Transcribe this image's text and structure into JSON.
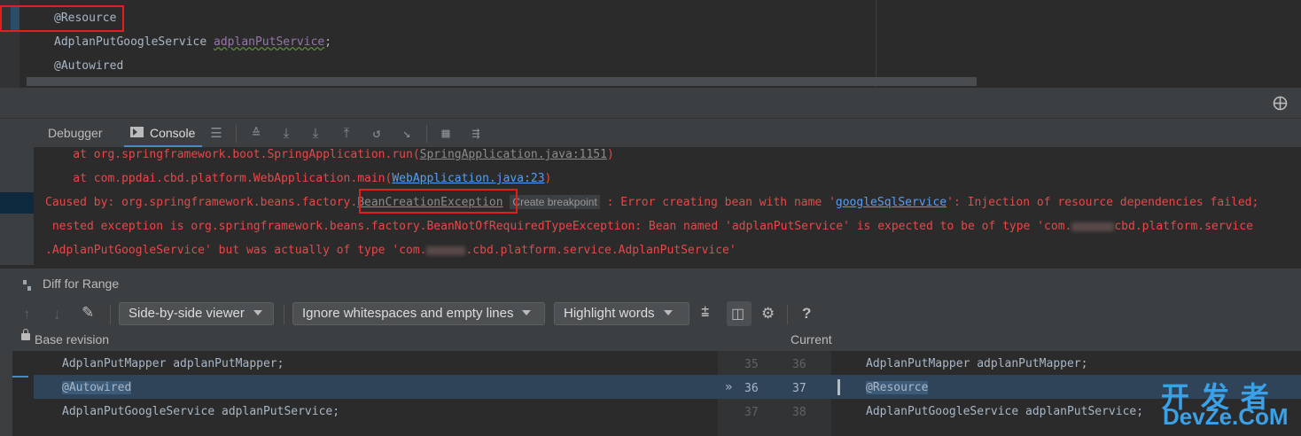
{
  "editor": {
    "lines": [
      {
        "kind": "annotation",
        "text": "@Resource"
      },
      {
        "type": "AdplanPutGoogleService",
        "field": "adplanPutService",
        "tail": ";"
      },
      {
        "kind": "annotation",
        "text": "@Autowired"
      }
    ]
  },
  "toolwindow": {
    "tabs": [
      {
        "label": "Debugger"
      },
      {
        "label": "Console"
      }
    ],
    "console": {
      "line1_prefix": "    at org.springframework.boot.SpringApplication.run(",
      "line1_link": "SpringApplication.java:1151",
      "line1_suffix": ")",
      "line2_prefix": "    at com.ppdai.cbd.platform.WebApplication.main(",
      "line2_link": "WebApplication.java:23",
      "line2_suffix": ")",
      "line3_prefix": "Caused by: org.springframework.beans.factory.",
      "line3_class": "BeanCreationException",
      "line3_hint": "Create breakpoint",
      "line3_mid": " : Error creating bean with name '",
      "line3_link": "googleSqlService",
      "line3_suffix": "': Injection of resource dependencies failed;",
      "line4_a": " nested exception is org.springframework.beans.factory.BeanNotOfRequiredTypeException: Bean named 'adplanPutService' is expected to be of type 'com.",
      "line4_b": "cbd.platform.service",
      "line5_a": ".AdplanPutGoogleService' but was actually of type 'com.",
      "line5_b": ".cbd.platform.service.AdplanPutService'"
    }
  },
  "diff": {
    "title": "Diff for Range",
    "viewer": "Side-by-side viewer",
    "whitespace": "Ignore whitespaces and empty lines",
    "highlight": "Highlight words",
    "help": "?",
    "left_label": "Base revision",
    "right_label": "Current",
    "rows": [
      {
        "left": "AdplanPutMapper adplanPutMapper;",
        "ln_left": "35",
        "ln_right": "36",
        "right": "AdplanPutMapper adplanPutMapper;"
      },
      {
        "left": "@Autowired",
        "ln_left": "36",
        "ln_right": "37",
        "right": "@Resource"
      },
      {
        "left": "AdplanPutGoogleService adplanPutService;",
        "ln_left": "37",
        "ln_right": "38",
        "right": "AdplanPutGoogleService adplanPutService;"
      }
    ]
  },
  "watermark": {
    "top": "开 发 者",
    "bottom": "DevZe.CoM"
  }
}
